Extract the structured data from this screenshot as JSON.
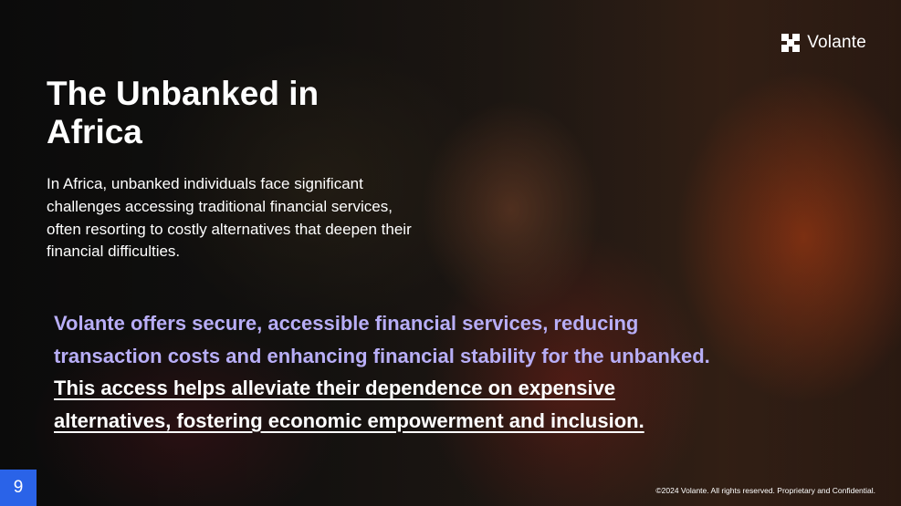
{
  "brand": {
    "name": "Volante",
    "logo_icon": "volante-logo-icon"
  },
  "slide": {
    "title_lines": [
      "The Unbanked in",
      "Africa"
    ],
    "intro_lines": [
      "In Africa, unbanked individuals face significant",
      "challenges accessing traditional financial services,",
      "often resorting to costly alternatives that deepen their",
      "financial difficulties."
    ],
    "highlight_lines": [
      "Volante offers secure, accessible financial services, reducing",
      "transaction costs and enhancing financial stability for the unbanked."
    ],
    "underlined_lines": [
      "This access helps alleviate their dependence on expensive",
      "alternatives, fostering economic empowerment and inclusion."
    ],
    "page_number": "9",
    "footer": "©2024 Volante. All rights reserved. Proprietary and Confidential."
  },
  "colors": {
    "accent_lavender": "#b8aef7",
    "page_badge": "#2a63e8",
    "text": "#ffffff"
  }
}
